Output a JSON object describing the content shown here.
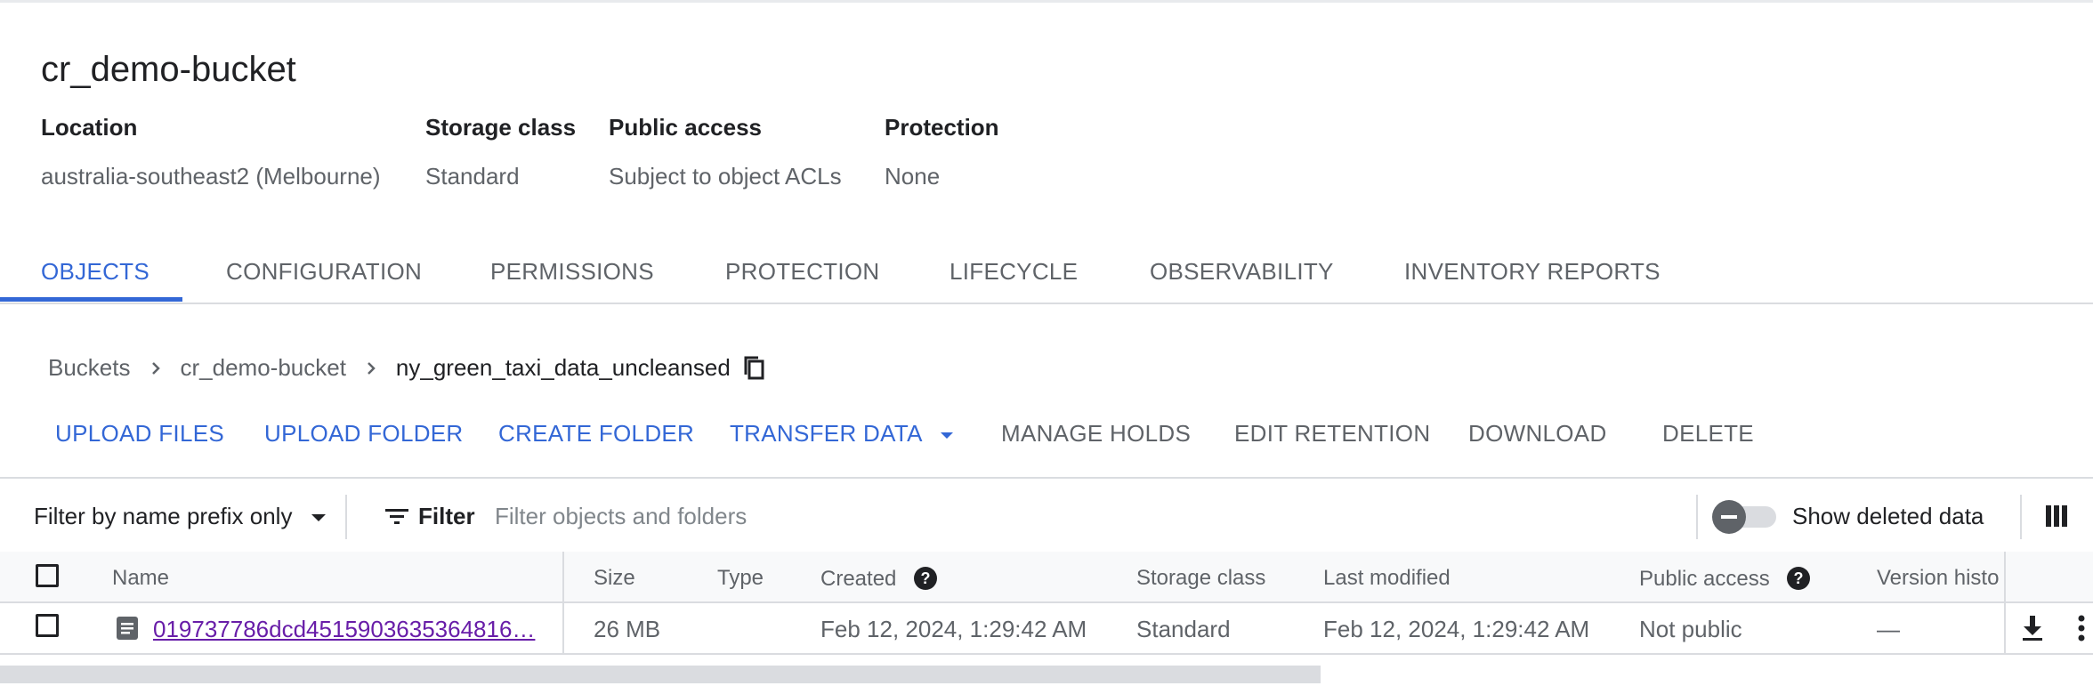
{
  "bucket": {
    "title": "cr_demo-bucket",
    "meta": [
      {
        "label": "Location",
        "value": "australia-southeast2 (Melbourne)"
      },
      {
        "label": "Storage class",
        "value": "Standard"
      },
      {
        "label": "Public access",
        "value": "Subject to object ACLs"
      },
      {
        "label": "Protection",
        "value": "None"
      }
    ]
  },
  "tabs": [
    "OBJECTS",
    "CONFIGURATION",
    "PERMISSIONS",
    "PROTECTION",
    "LIFECYCLE",
    "OBSERVABILITY",
    "INVENTORY REPORTS"
  ],
  "active_tab": "OBJECTS",
  "breadcrumb": [
    "Buckets",
    "cr_demo-bucket",
    "ny_green_taxi_data_uncleansed"
  ],
  "actions": {
    "upload_files": "UPLOAD FILES",
    "upload_folder": "UPLOAD FOLDER",
    "create_folder": "CREATE FOLDER",
    "transfer_data": "TRANSFER DATA",
    "manage_holds": "MANAGE HOLDS",
    "edit_retention": "EDIT RETENTION",
    "download": "DOWNLOAD",
    "delete": "DELETE"
  },
  "filter": {
    "mode": "Filter by name prefix only",
    "label": "Filter",
    "placeholder": "Filter objects and folders",
    "show_deleted": "Show deleted data"
  },
  "table": {
    "columns": [
      "Name",
      "Size",
      "Type",
      "Created",
      "Storage class",
      "Last modified",
      "Public access",
      "Version histo"
    ],
    "rows": [
      {
        "name": "019737786dcd4515903635364816…",
        "size": "26 MB",
        "type": "",
        "created": "Feb 12, 2024, 1:29:42 AM",
        "storage_class": "Standard",
        "last_modified": "Feb 12, 2024, 1:29:42 AM",
        "public_access": "Not public",
        "version_history": "—"
      }
    ]
  },
  "colors": {
    "accent": "#3367d6",
    "link_visited": "#681da8",
    "muted": "#5f6368"
  }
}
